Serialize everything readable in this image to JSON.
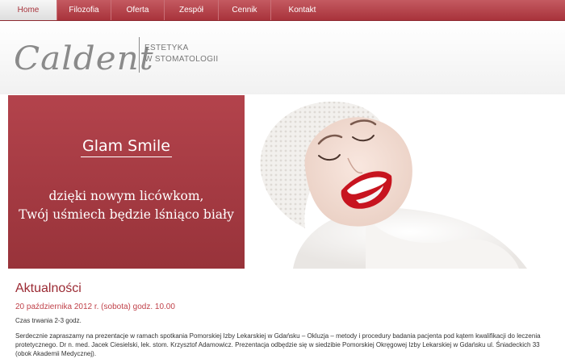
{
  "nav": {
    "items": [
      {
        "label": "Home",
        "active": true
      },
      {
        "label": "Filozofia",
        "active": false
      },
      {
        "label": "Oferta",
        "active": false
      },
      {
        "label": "Zespół",
        "active": false
      },
      {
        "label": "Cennik",
        "active": false
      },
      {
        "label": "Kontakt",
        "active": false
      }
    ]
  },
  "header": {
    "logo_text": "Caldent",
    "logo_sub_line1": "ESTETYKA",
    "logo_sub_line2": "W STOMATOLOGII"
  },
  "banner": {
    "title": "Glam Smile",
    "tagline_line1": "dzięki nowym licówkom,",
    "tagline_line2": "Twój uśmiech będzie lśniąco biały"
  },
  "news": {
    "heading": "Aktualności",
    "date": "20 października 2012 r. (sobota) godz. 10.00",
    "duration": "Czas trwania 2-3 godz.",
    "body": "Serdecznie zapraszamy na prezentacje w ramach spotkania Pomorskiej Izby Lekarskiej w Gdańsku – Okluzja – metody i procedury badania pacjenta pod kątem kwalifikacji do leczenia protetycznego. Dr n. med. Jacek Ciesielski, lek. stom. Krzysztof Adamowicz. Prezentacja odbędzie się w siedzibie Pomorskiej Okręgowej Izby Lekarskiej w Gdańsku  ul. Śniadeckich 33 (obok Akademii Medycznej)."
  },
  "colors": {
    "brand": "#a8333b",
    "nav_active_text": "#a8333b",
    "heading": "#9b2a33",
    "date": "#c0424a"
  }
}
